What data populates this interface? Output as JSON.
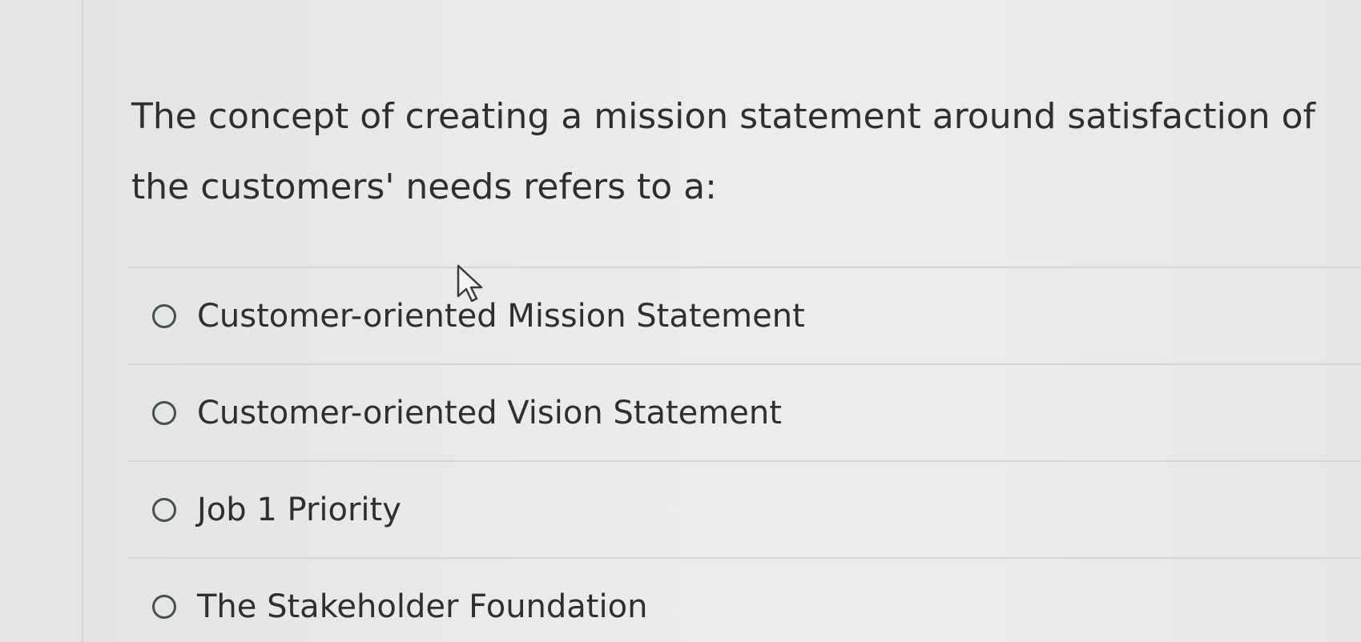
{
  "question": {
    "text": "The concept of creating a mission statement around satisfaction of the customers' needs refers to a:"
  },
  "answers": [
    {
      "label": "Customer-oriented Mission Statement",
      "selected": false
    },
    {
      "label": "Customer-oriented Vision Statement",
      "selected": false
    },
    {
      "label": "Job 1 Priority",
      "selected": false
    },
    {
      "label": "The Stakeholder Foundation",
      "selected": false
    }
  ],
  "icons": {
    "radio": "radio-unchecked-icon",
    "cursor": "mouse-pointer-icon"
  },
  "colors": {
    "text": "#2d2f31",
    "divider": "#d4d6d6",
    "background": "#eaebeb"
  }
}
